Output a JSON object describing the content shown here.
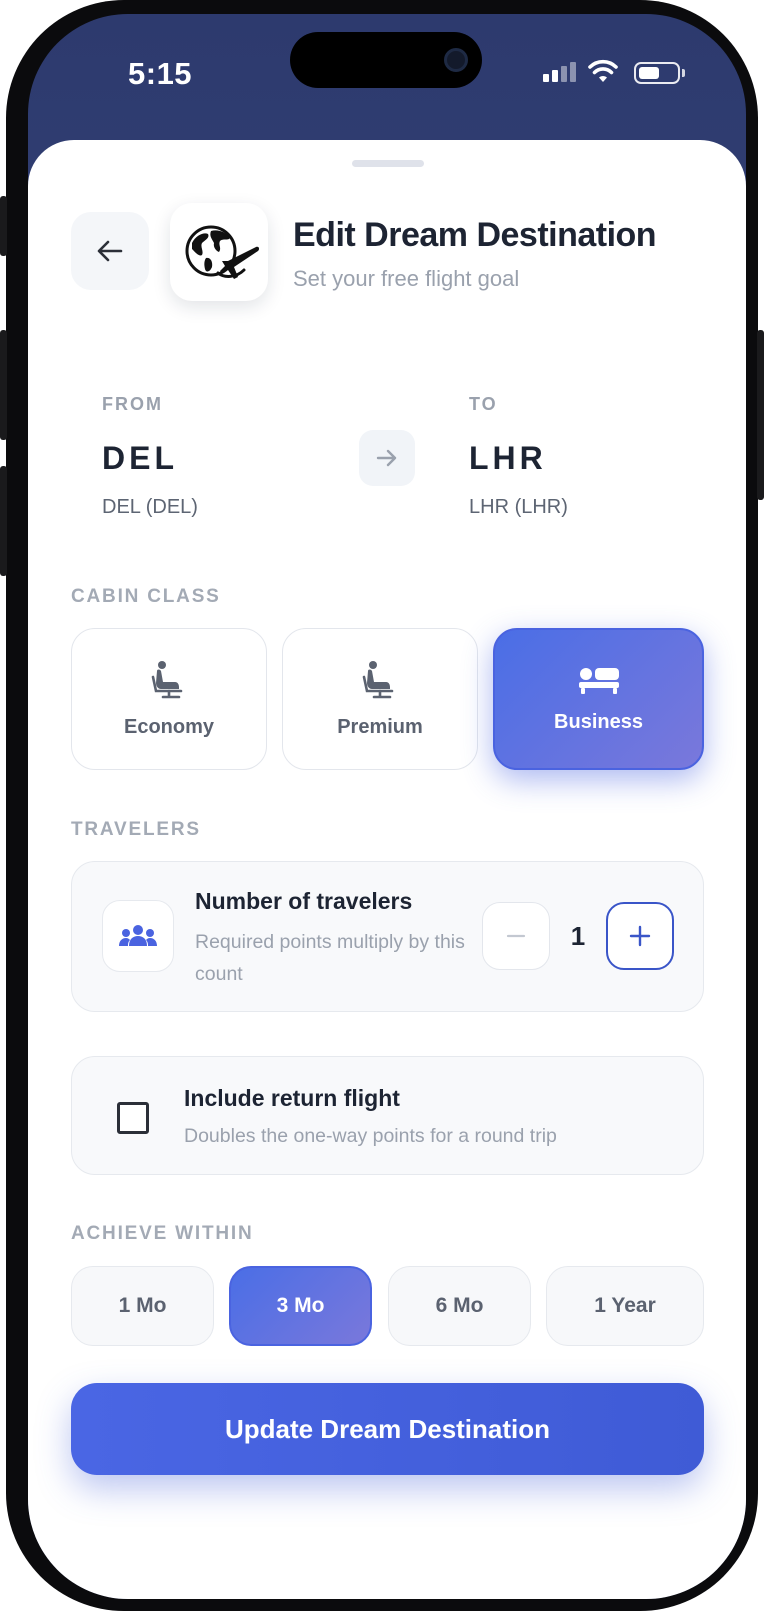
{
  "status_bar": {
    "time": "5:15",
    "icons": [
      "signal-icon",
      "wifi-icon",
      "battery-icon"
    ]
  },
  "header": {
    "back_icon": "arrow-left-icon",
    "logo_icon": "globe-airplane-logo",
    "title": "Edit Dream Destination",
    "subtitle": "Set your free flight goal"
  },
  "route": {
    "from_label": "FROM",
    "from_code": "DEL",
    "from_sub": "DEL (DEL)",
    "to_label": "TO",
    "to_code": "LHR",
    "to_sub": "LHR (LHR)",
    "arrow_icon": "arrow-right-icon"
  },
  "cabin": {
    "label": "CABIN CLASS",
    "options": [
      {
        "label": "Economy",
        "icon": "seat-icon",
        "selected": false
      },
      {
        "label": "Premium",
        "icon": "seat-icon",
        "selected": false
      },
      {
        "label": "Business",
        "icon": "flat-bed-icon",
        "selected": true
      }
    ]
  },
  "travelers": {
    "label": "TRAVELERS",
    "title": "Number of travelers",
    "description": "Required points multiply by this count",
    "count": "1",
    "icon": "users-icon"
  },
  "return_flight": {
    "title": "Include return flight",
    "description": "Doubles the one-way points for a round trip",
    "checked": false
  },
  "achieve": {
    "label": "ACHIEVE WITHIN",
    "options": [
      {
        "label": "1 Mo",
        "selected": false
      },
      {
        "label": "3 Mo",
        "selected": true
      },
      {
        "label": "6 Mo",
        "selected": false
      },
      {
        "label": "1 Year",
        "selected": false
      }
    ]
  },
  "cta": {
    "label": "Update Dream Destination"
  },
  "colors": {
    "accent": "#4a66e4",
    "accent_gradient_end": "#7a78db",
    "header_bg": "#2d3a6e",
    "text_dark": "#1d2433",
    "text_muted": "#9aa1ad"
  }
}
